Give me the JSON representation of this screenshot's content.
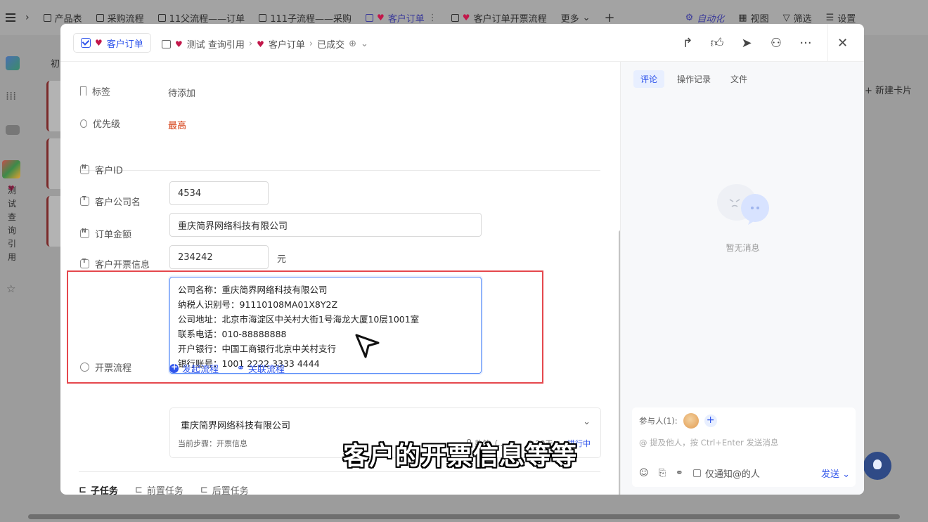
{
  "topbar": {
    "tabs": [
      {
        "label": "产品表",
        "active": false,
        "heart": false
      },
      {
        "label": "采购流程",
        "active": false,
        "heart": false
      },
      {
        "label": "11父流程——订单",
        "active": false,
        "heart": false
      },
      {
        "label": "111子流程——采购",
        "active": false,
        "heart": false
      },
      {
        "label": "客户订单",
        "active": true,
        "heart": true
      },
      {
        "label": "客户订单开票流程",
        "active": false,
        "heart": true
      }
    ],
    "more_label": "更多",
    "automation_label": "自动化",
    "view_label": "视图",
    "filter_label": "筛选",
    "settings_label": "设置"
  },
  "background": {
    "vertical_label": "测试查询引用",
    "left_stub": "初",
    "new_card_label": "新建卡片"
  },
  "modal": {
    "current_tab": "客户订单",
    "breadcrumb": {
      "item1": "测试 查询引用",
      "item2": "客户订单",
      "item3": "已成交"
    },
    "fields": {
      "tag_label": "标签",
      "tag_value": "待添加",
      "priority_label": "优先级",
      "priority_value": "最高",
      "customer_id_label": "客户ID",
      "customer_id_value": "4534",
      "company_label": "客户公司名",
      "company_value": "重庆简界网络科技有限公司",
      "amount_label": "订单金额",
      "amount_value": "234242",
      "amount_unit": "元",
      "invoice_label": "客户开票信息",
      "invoice_lines": [
        "公司名称：重庆简界网络科技有限公司",
        "纳税人识别号：91110108MA01X8Y2Z",
        "公司地址：北京市海淀区中关村大街1号海龙大厦10层1001室",
        "联系电话：010-88888888",
        "开户银行：中国工商银行北京中关村支行",
        "银行账号：1001 2222 3333 4444"
      ],
      "flow_label": "开票流程",
      "start_flow": "发起流程",
      "link_flow": "关联流程"
    },
    "flow_card": {
      "title": "重庆简界网络科技有限公司",
      "step": "当前步骤：开票信息",
      "assignee": "盐然（...",
      "duration": "2.29天",
      "status": "进行中"
    },
    "subtabs": [
      "子任务",
      "前置任务",
      "后置任务"
    ]
  },
  "right_panel": {
    "tabs": [
      "评论",
      "操作记录",
      "文件"
    ],
    "empty_text": "暂无消息",
    "participants_label": "参与人(1):",
    "comment_placeholder": "@ 提及他人，按 Ctrl+Enter 发送消息",
    "notify_label": "仅通知@的人",
    "send_label": "发送"
  },
  "subtitle": "客户的开票信息等等",
  "colors": {
    "accent": "#2f54eb",
    "priority_red": "#d4380d",
    "highlight_box": "#e5484d"
  }
}
